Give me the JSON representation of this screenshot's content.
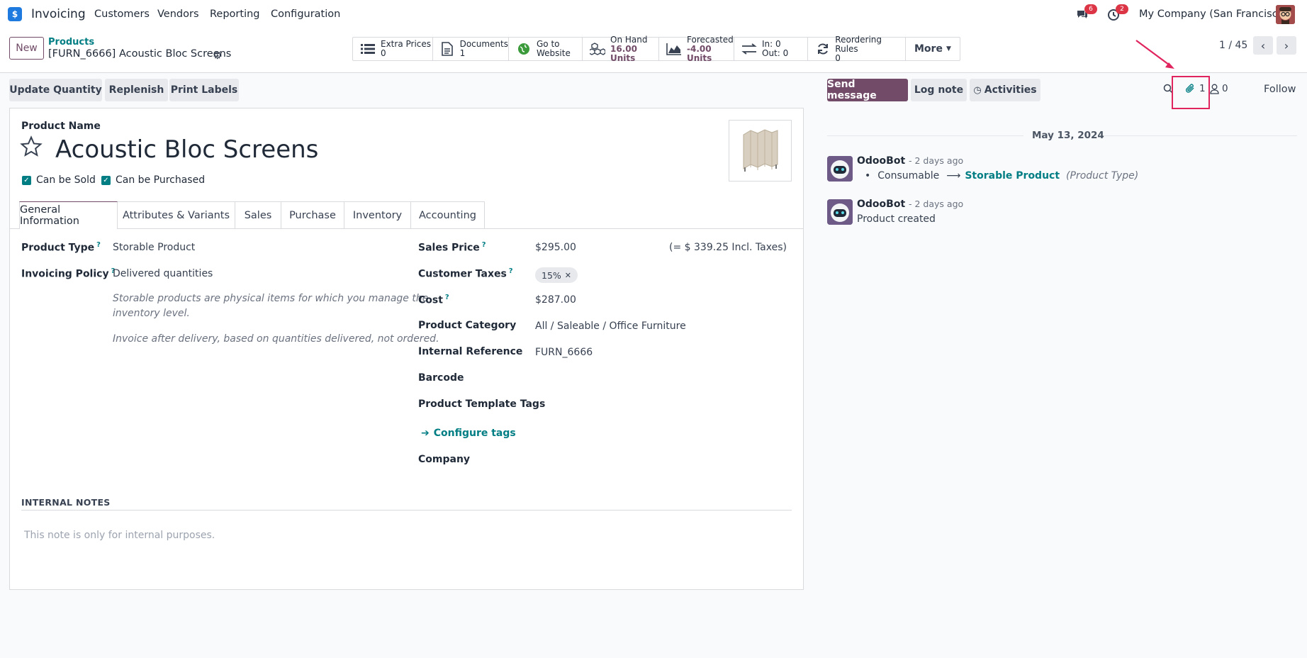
{
  "navbar": {
    "app_icon": "$",
    "app_name": "Invoicing",
    "menu": [
      "Customers",
      "Vendors",
      "Reporting",
      "Configuration"
    ],
    "messages_count": "6",
    "activities_count": "2",
    "company": "My Company (San Francisco)"
  },
  "control": {
    "new_label": "New",
    "breadcrumb_parent": "Products",
    "breadcrumb_current": "[FURN_6666] Acoustic Bloc Screens",
    "smart_buttons": [
      {
        "label": "Extra Prices",
        "value": "0",
        "icon": "list-icon"
      },
      {
        "label": "Documents",
        "value": "1",
        "icon": "document-icon"
      },
      {
        "label": "Go to",
        "value": "Website",
        "icon": "globe-icon"
      },
      {
        "label": "On Hand",
        "value": "16.00 Units",
        "icon": "cubes-icon"
      },
      {
        "label": "Forecasted",
        "value": "-4.00 Units",
        "icon": "area-chart-icon"
      },
      {
        "label": "In: 0",
        "value": "Out: 0",
        "icon": "exchange-icon"
      },
      {
        "label": "Reordering Rules",
        "value": "0",
        "icon": "refresh-icon"
      }
    ],
    "more_label": "More",
    "pager": "1 / 45"
  },
  "actions": {
    "update_quantity": "Update Quantity",
    "replenish": "Replenish",
    "print_labels": "Print Labels"
  },
  "form": {
    "product_name_label": "Product Name",
    "product_name": "Acoustic Bloc Screens",
    "can_be_sold": "Can be Sold",
    "can_be_purchased": "Can be Purchased",
    "tabs": [
      "General Information",
      "Attributes & Variants",
      "Sales",
      "Purchase",
      "Inventory",
      "Accounting"
    ],
    "product_type_label": "Product Type",
    "product_type": "Storable Product",
    "invoicing_policy_label": "Invoicing Policy",
    "invoicing_policy": "Delivered quantities",
    "note_storable_1": "Storable products are physical items for which you manage the",
    "note_storable_2": "inventory level.",
    "note_invoice": "Invoice after delivery, based on quantities delivered, not ordered.",
    "sales_price_label": "Sales Price",
    "sales_price": "$295.00",
    "sales_price_incl": "(= $ 339.25 Incl. Taxes)",
    "customer_taxes_label": "Customer Taxes",
    "customer_tax_tag": "15%",
    "cost_label": "Cost",
    "cost": "$287.00",
    "category_label": "Product Category",
    "category": "All / Saleable / Office Furniture",
    "internal_ref_label": "Internal Reference",
    "internal_ref": "FURN_6666",
    "barcode_label": "Barcode",
    "tags_label": "Product Template Tags",
    "configure_tags": "Configure tags",
    "company_label": "Company",
    "internal_notes_title": "INTERNAL NOTES",
    "internal_notes_placeholder": "This note is only for internal purposes."
  },
  "chatter": {
    "send_message": "Send message",
    "log_note": "Log note",
    "activities": "Activities",
    "attachments_count": "1",
    "followers_count": "0",
    "follow": "Follow",
    "date": "May 13, 2024",
    "messages": [
      {
        "author": "OdooBot",
        "time": "- 2 days ago",
        "from": "Consumable",
        "to": "Storable Product",
        "field": "(Product Type)"
      },
      {
        "author": "OdooBot",
        "time": "- 2 days ago",
        "body": "Product created"
      }
    ]
  },
  "colors": {
    "primary": "#714b67",
    "link": "#017e84",
    "annotation": "#e0245e"
  }
}
